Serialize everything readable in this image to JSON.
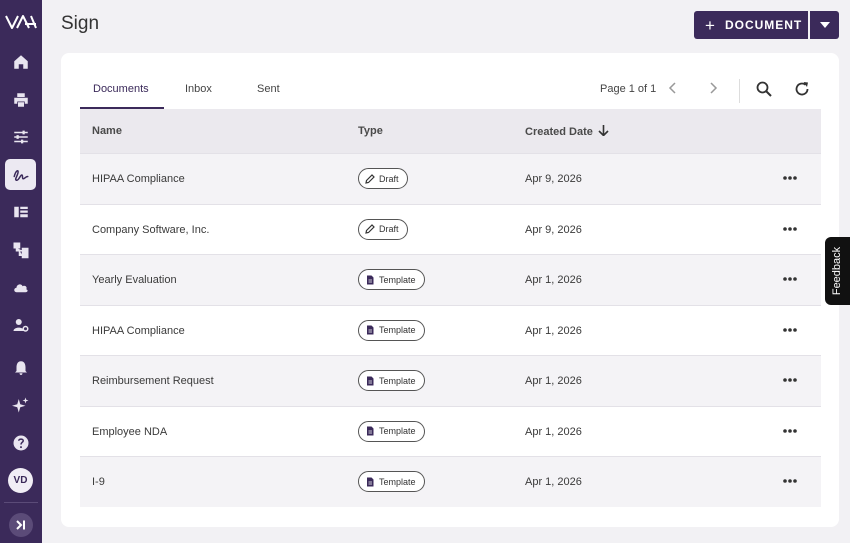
{
  "sidebar": {
    "items": [
      {
        "name": "home-icon"
      },
      {
        "name": "printer-icon"
      },
      {
        "name": "sliders-icon"
      },
      {
        "name": "signature-icon",
        "active": true
      },
      {
        "name": "library-icon"
      },
      {
        "name": "workflow-icon"
      },
      {
        "name": "cloud-icon"
      },
      {
        "name": "user-settings-icon"
      },
      {
        "name": "bell-icon"
      },
      {
        "name": "sparkles-icon"
      },
      {
        "name": "help-icon"
      }
    ],
    "avatar_initials": "VD"
  },
  "header": {
    "title": "Sign",
    "new_document_label": "DOCUMENT"
  },
  "tabs": [
    "Documents",
    "Inbox",
    "Sent"
  ],
  "pagination": {
    "label": "Page 1 of 1"
  },
  "table": {
    "headers": {
      "name": "Name",
      "type": "Type",
      "created": "Created Date"
    },
    "rows": [
      {
        "name": "HIPAA Compliance",
        "type": "Draft",
        "date": "Apr 9, 2026"
      },
      {
        "name": "Company Software, Inc.",
        "type": "Draft",
        "date": "Apr 9, 2026"
      },
      {
        "name": "Yearly Evaluation",
        "type": "Template",
        "date": "Apr 1, 2026"
      },
      {
        "name": "HIPAA Compliance",
        "type": "Template",
        "date": "Apr 1, 2026"
      },
      {
        "name": "Reimbursement Request",
        "type": "Template",
        "date": "Apr 1, 2026"
      },
      {
        "name": "Employee NDA",
        "type": "Template",
        "date": "Apr 1, 2026"
      },
      {
        "name": "I-9",
        "type": "Template",
        "date": "Apr 1, 2026"
      }
    ]
  },
  "feedback_label": "Feedback",
  "colors": {
    "brand": "#3b2a5a",
    "background": "#f2f1f4",
    "header_row": "#ebe9ee"
  }
}
